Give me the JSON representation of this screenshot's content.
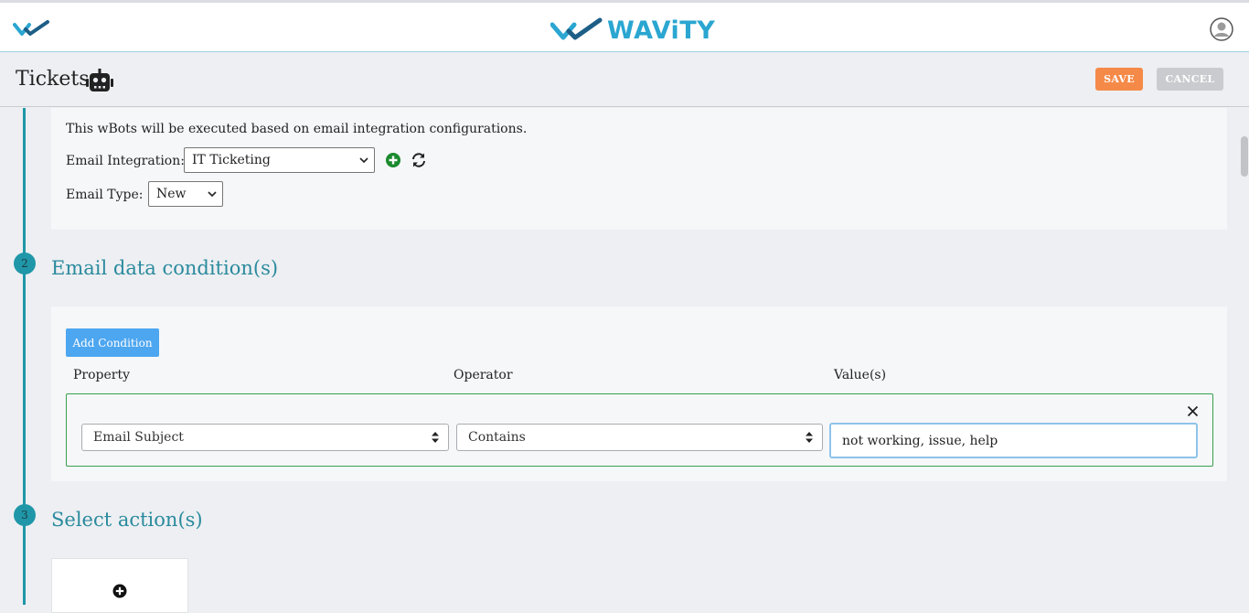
{
  "brand": {
    "name": "WAViTY"
  },
  "header": {
    "title": "Tickets",
    "save_label": "SAVE",
    "cancel_label": "CANCEL"
  },
  "section1": {
    "description": "This wBots will be executed based on email integration configurations.",
    "email_integration_label": "Email Integration:",
    "email_integration_value": "IT Ticketing",
    "email_type_label": "Email Type:",
    "email_type_value": "New"
  },
  "section2": {
    "step": "2",
    "title": "Email data condition(s)",
    "add_condition_label": "Add Condition",
    "columns": {
      "property": "Property",
      "operator": "Operator",
      "values": "Value(s)"
    },
    "condition": {
      "property": "Email Subject",
      "operator": "Contains",
      "value": "not working, issue, help"
    }
  },
  "section3": {
    "step": "3",
    "title": "Select action(s)"
  },
  "colors": {
    "accent": "#1f97a8",
    "save": "#f58a48",
    "cancel": "#c9cbce",
    "add_condition": "#4da6f0",
    "brand": "#2aa6d1"
  }
}
